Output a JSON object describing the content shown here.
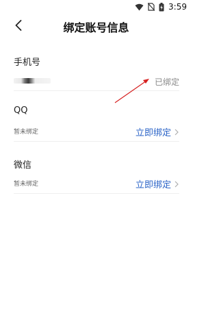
{
  "status_bar": {
    "time": "3:59"
  },
  "header": {
    "title": "绑定账号信息"
  },
  "phone": {
    "title": "手机号",
    "status": "已绑定"
  },
  "qq": {
    "title": "QQ",
    "status": "暂未绑定",
    "action": "立即绑定"
  },
  "wechat": {
    "title": "微信",
    "status": "暂未绑定",
    "action": "立即绑定"
  },
  "colors": {
    "link": "#2a63c7",
    "annotation": "#d62020"
  }
}
